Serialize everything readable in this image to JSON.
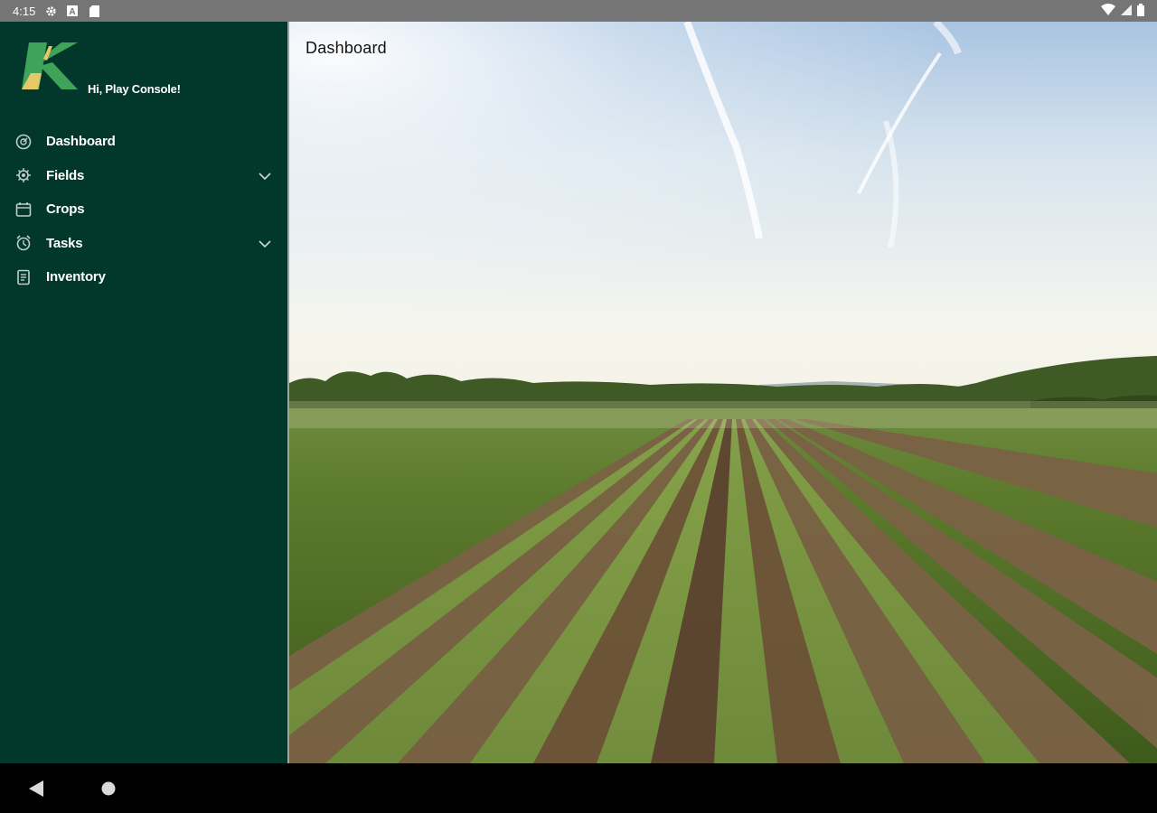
{
  "status_bar": {
    "time": "4:15",
    "left_icons": [
      "settings-icon",
      "a-box-icon",
      "sd-card-icon"
    ],
    "right_icons": [
      "wifi-icon",
      "signal-icon",
      "battery-icon"
    ]
  },
  "drawer": {
    "greeting": "Hi, Play Console!",
    "logo": "K",
    "items": [
      {
        "label": "Dashboard",
        "icon": "dashboard-icon",
        "expandable": false
      },
      {
        "label": "Fields",
        "icon": "fields-icon",
        "expandable": true
      },
      {
        "label": "Crops",
        "icon": "crops-icon",
        "expandable": false
      },
      {
        "label": "Tasks",
        "icon": "tasks-icon",
        "expandable": true
      },
      {
        "label": "Inventory",
        "icon": "inventory-icon",
        "expandable": false
      }
    ]
  },
  "main": {
    "title": "Dashboard",
    "hero_image": "farm-field-photo"
  },
  "nav_bar": {
    "buttons": [
      "back-button",
      "home-button"
    ]
  },
  "colors": {
    "drawer_bg": "#02382b",
    "status_bar": "#757575",
    "logo_green": "#3fa35a",
    "logo_yellow": "#e6c86a"
  }
}
